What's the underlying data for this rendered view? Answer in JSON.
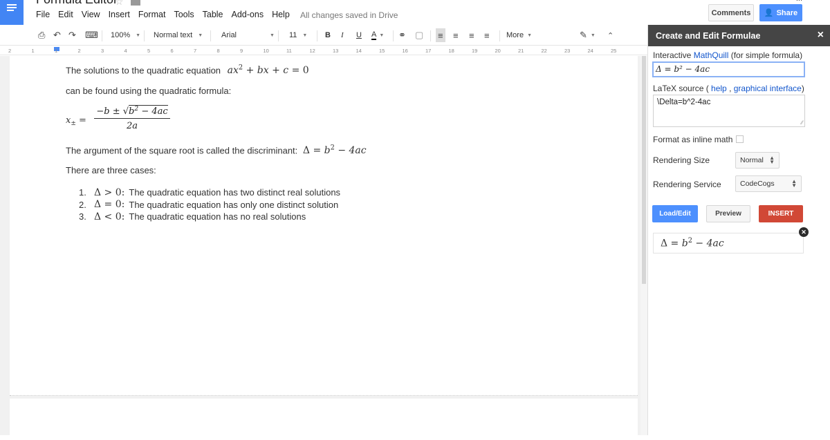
{
  "app": {
    "doc_title": "Formula Editor",
    "account_email": "...",
    "save_status": "All changes saved in Drive",
    "comments_label": "Comments",
    "share_label": "Share"
  },
  "menu": [
    "File",
    "Edit",
    "View",
    "Insert",
    "Format",
    "Tools",
    "Table",
    "Add-ons",
    "Help"
  ],
  "toolbar": {
    "zoom": "100%",
    "style": "Normal text",
    "font": "Arial",
    "size": "11",
    "bold": "B",
    "italic": "I",
    "underline": "U",
    "text_color": "A",
    "more": "More",
    "icons": [
      "print-icon",
      "undo-icon",
      "redo-icon",
      "paint-format-icon",
      "link-icon",
      "comment-icon",
      "align-left-icon",
      "align-center-icon",
      "align-right-icon",
      "justify-icon",
      "pencil-icon",
      "collapse-icon"
    ]
  },
  "ruler": [
    "2",
    "1",
    "1",
    "2",
    "3",
    "4",
    "5",
    "6",
    "7",
    "8",
    "9",
    "10",
    "11",
    "12",
    "13",
    "14",
    "15",
    "16",
    "17",
    "18",
    "19",
    "20",
    "21",
    "22",
    "23",
    "24",
    "25"
  ],
  "document": {
    "line1_text": "The solutions to the quadratic equation",
    "line1_math": "ax² + bx + c = 0",
    "line2": "can be found using the quadratic formula:",
    "formula_lhs": "x± =",
    "formula_num": "−b ± √b² − 4ac",
    "formula_den": "2a",
    "line3_text": "The argument of the square root is called the discriminant:",
    "line3_math": "Δ = b² − 4ac",
    "line4": "There are three cases:",
    "cases": [
      {
        "num": "1.",
        "math": "Δ > 0:",
        "text": "The quadratic equation has two distinct real solutions"
      },
      {
        "num": "2.",
        "math": "Δ = 0:",
        "text": "The quadratic equation has only one distinct solution"
      },
      {
        "num": "3.",
        "math": "Δ < 0:",
        "text": "The quadratic equation has no real solutions"
      }
    ]
  },
  "panel": {
    "title": "Create and Edit Formulae",
    "close": "×",
    "mq_label_pre": "Interactive ",
    "mq_label_link": "MathQuill",
    "mq_label_post": " (for simple formula)",
    "mq_value": "Δ = b² − 4ac",
    "latex_label_pre": "LaTeX source ( ",
    "latex_help": "help",
    "latex_sep": " , ",
    "latex_gui": "graphical interface",
    "latex_label_post": ")",
    "latex_value": "\\Delta=b^2-4ac",
    "inline_label": "Format as inline math",
    "size_label": "Rendering Size",
    "size_value": "Normal",
    "service_label": "Rendering Service",
    "service_value": "CodeCogs",
    "load_label": "Load/Edit",
    "preview_label": "Preview",
    "insert_label": "INSERT",
    "preview_math": "Δ = b² − 4ac"
  },
  "colors": {
    "docs_blue": "#4285f4",
    "share_blue": "#4d90fe",
    "insert_red": "#d14836",
    "panel_header": "#454545",
    "link": "#1155cc"
  }
}
